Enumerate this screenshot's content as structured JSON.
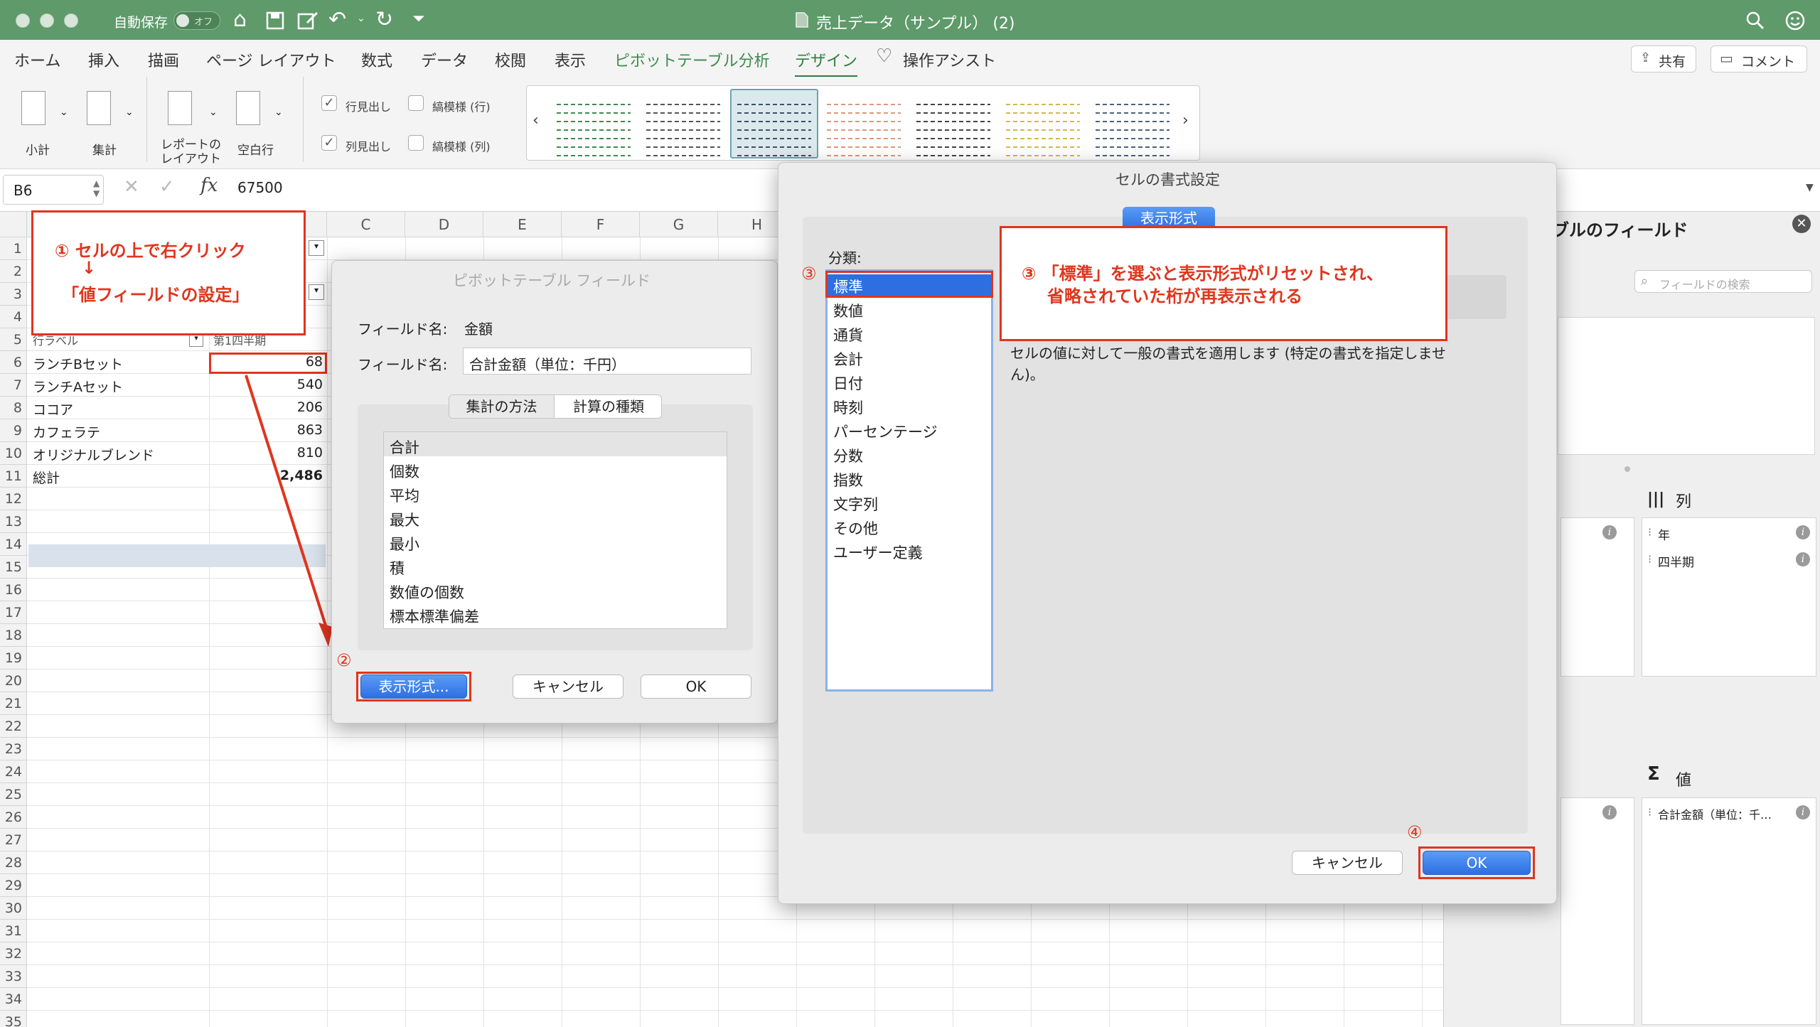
{
  "titlebar": {
    "autosave_label": "自動保存",
    "autosave_state": "オフ",
    "doc_title": "売上データ（サンプル） (2)"
  },
  "ribbon_tabs": [
    "ホーム",
    "挿入",
    "描画",
    "ページ レイアウト",
    "数式",
    "データ",
    "校閲",
    "表示",
    "ピボットテーブル分析",
    "デザイン",
    "操作アシスト"
  ],
  "ribbon_right": {
    "share": "共有",
    "comment": "コメント"
  },
  "ribbon": {
    "subtotal": "小計",
    "grandtotal": "集計",
    "report_layout_1": "レポートの",
    "report_layout_2": "レイアウト",
    "blank_rows": "空白行",
    "row_headers": "行見出し",
    "col_headers": "列見出し",
    "banded_rows": "縞模様 (行)",
    "banded_cols": "縞模様 (列)"
  },
  "formula": {
    "cell_ref": "B6",
    "fx": "fx",
    "value": "67500"
  },
  "columns": [
    "C",
    "D",
    "E",
    "F",
    "G",
    "H"
  ],
  "rows": [
    "1",
    "2",
    "3",
    "4",
    "5",
    "6",
    "7",
    "8",
    "9",
    "10",
    "11",
    "12",
    "13",
    "14",
    "15",
    "16",
    "17",
    "18",
    "19",
    "20",
    "21",
    "22",
    "23",
    "24",
    "25",
    "26",
    "27",
    "28",
    "29",
    "30",
    "31",
    "32",
    "33",
    "34",
    "35"
  ],
  "pivot": {
    "row5_label": "行ラベル",
    "row5_quarter": "第1四半期",
    "items": [
      {
        "name": "ランチBセット",
        "value": "68"
      },
      {
        "name": "ランチAセット",
        "value": "540"
      },
      {
        "name": "ココア",
        "value": "206"
      },
      {
        "name": "カフェラテ",
        "value": "863"
      },
      {
        "name": "オリジナルブレンド",
        "value": "810"
      }
    ],
    "total_label": "総計",
    "total_value": "2,486"
  },
  "annotations": {
    "step1_line1": "① セルの上で右クリック",
    "step1_arrow": "↓",
    "step1_line2": "「値フィールドの設定」",
    "step2_num": "②",
    "step3_num": "③",
    "step3_line1": "③ 「標準」を選ぶと表示形式がリセットされ、",
    "step3_line2": "省略されていた桁が再表示される",
    "step4_num": "④"
  },
  "pivot_dialog": {
    "title": "ピボットテーブル フィールド",
    "source_label": "フィールド名:",
    "source_value": "金額",
    "name_label": "フィールド名:",
    "name_value": "合計金額（単位：千円）",
    "tab_summarize": "集計の方法",
    "tab_calc": "計算の種類",
    "functions": [
      "合計",
      "個数",
      "平均",
      "最大",
      "最小",
      "積",
      "数値の個数",
      "標本標準偏差"
    ],
    "format_button": "表示形式...",
    "cancel": "キャンセル",
    "ok": "OK"
  },
  "format_dialog": {
    "title": "セルの書式設定",
    "tab": "表示形式",
    "category_label": "分類:",
    "categories": [
      "標準",
      "数値",
      "通貨",
      "会計",
      "日付",
      "時刻",
      "パーセンテージ",
      "分数",
      "指数",
      "文字列",
      "その他",
      "ユーザー定義"
    ],
    "description": "セルの値に対して一般の書式を適用します (特定の書式を指定しませ",
    "description2": "ん)。",
    "cancel": "キャンセル",
    "ok": "OK"
  },
  "field_panel": {
    "title": "ブルのフィールド",
    "search_placeholder": "フィールドの検索",
    "columns_label": "列",
    "col_fields": [
      "年",
      "四半期"
    ],
    "values_label": "値",
    "value_fields": [
      "合計金額（単位：千…"
    ]
  }
}
